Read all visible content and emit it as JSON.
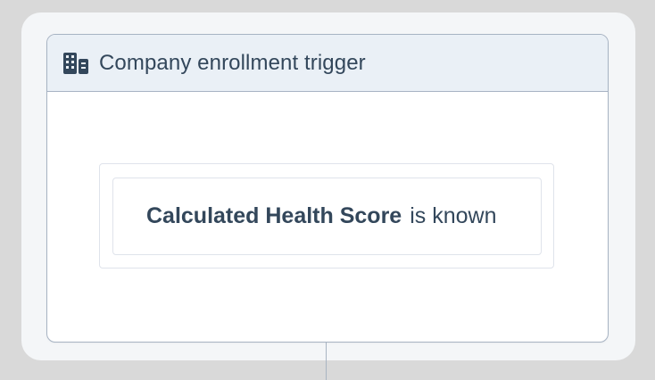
{
  "trigger": {
    "header_icon": "building-icon",
    "title": "Company enrollment trigger",
    "criteria": {
      "property": "Calculated Health Score",
      "operator": "is known"
    }
  },
  "colors": {
    "page_bg": "#d9d9d9",
    "frame_bg": "#f4f6f8",
    "header_bg": "#eaf0f6",
    "border": "#a7b3c3",
    "text": "#33475b"
  }
}
